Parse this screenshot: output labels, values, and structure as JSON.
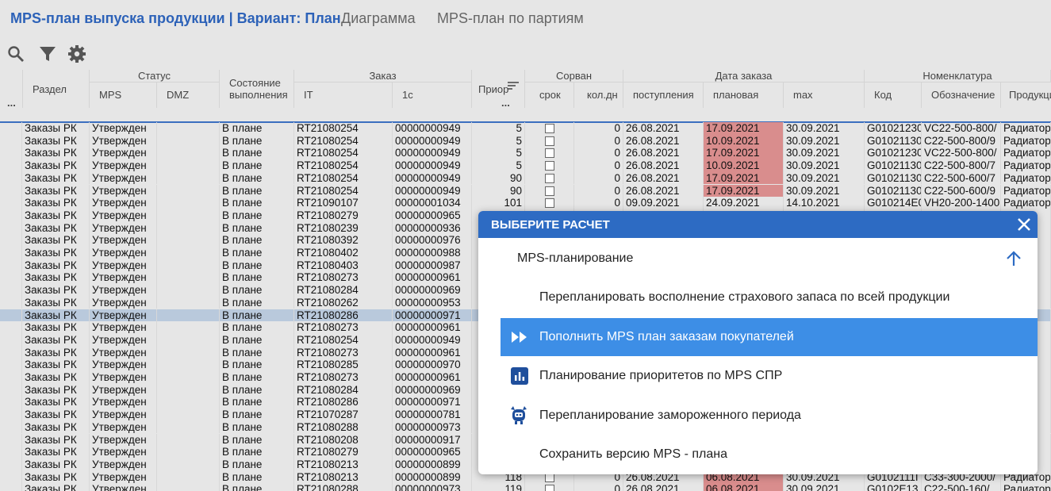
{
  "tabs": [
    {
      "label": "MPS-план выпуска продукции | Вариант: План",
      "active": true
    },
    {
      "label": "Диаграмма",
      "active": false
    },
    {
      "label": "MPS-план по партиям",
      "active": false
    }
  ],
  "toolbar": {
    "icons": [
      "search-icon",
      "filter-icon",
      "gear-icon"
    ]
  },
  "grid": {
    "header_groups": [
      "Статус",
      "Заказ",
      "Сорван",
      "Дата заказа",
      "Номенклатура"
    ],
    "columns": [
      "Раздел",
      "MPS",
      "DMZ",
      "Состояние выполнения",
      "IT",
      "1с",
      "Приор",
      "срок",
      "кол.дн",
      "поступления",
      "плановая",
      "max",
      "Код",
      "Обозначение",
      "Продукция"
    ],
    "more_label": "...",
    "rows": [
      [
        "Заказы РК",
        "Утвержден",
        "",
        "В плане",
        "RT21080254",
        "00000000949",
        "5",
        "",
        "0",
        "26.08.2021",
        "17.09.2021",
        "30.09.2021",
        "G01021230",
        "VC22-500-800/",
        "Радиатор"
      ],
      [
        "Заказы РК",
        "Утвержден",
        "",
        "В плане",
        "RT21080254",
        "00000000949",
        "5",
        "",
        "0",
        "26.08.2021",
        "10.09.2021",
        "30.09.2021",
        "G01021130",
        "C22-500-800/9",
        "Радиатор"
      ],
      [
        "Заказы РК",
        "Утвержден",
        "",
        "В плане",
        "RT21080254",
        "00000000949",
        "5",
        "",
        "0",
        "26.08.2021",
        "17.09.2021",
        "30.09.2021",
        "G01021230",
        "VC22-500-800/",
        "Радиатор"
      ],
      [
        "Заказы РК",
        "Утвержден",
        "",
        "В плане",
        "RT21080254",
        "00000000949",
        "5",
        "",
        "0",
        "26.08.2021",
        "10.09.2021",
        "30.09.2021",
        "G01021130",
        "C22-500-800/7",
        "Радиатор"
      ],
      [
        "Заказы РК",
        "Утвержден",
        "",
        "В плане",
        "RT21080254",
        "00000000949",
        "90",
        "",
        "0",
        "26.08.2021",
        "17.09.2021",
        "30.09.2021",
        "G01021130",
        "C22-500-600/7",
        "Радиатор"
      ],
      [
        "Заказы РК",
        "Утвержден",
        "",
        "В плане",
        "RT21080254",
        "00000000949",
        "90",
        "",
        "0",
        "26.08.2021",
        "17.09.2021",
        "30.09.2021",
        "G01021130",
        "C22-500-600/9",
        "Радиатор"
      ],
      [
        "Заказы РК",
        "Утвержден",
        "",
        "В плане",
        "RT21090107",
        "00000001034",
        "101",
        "",
        "0",
        "09.09.2021",
        "24.09.2021",
        "14.10.2021",
        "G010214E0",
        "VH20-200-1400",
        "Радиатор"
      ],
      [
        "Заказы РК",
        "Утвержден",
        "",
        "В плане",
        "RT21080279",
        "00000000965",
        "",
        "",
        "",
        "",
        "",
        "",
        "",
        "",
        ""
      ],
      [
        "Заказы РК",
        "Утвержден",
        "",
        "В плане",
        "RT21080239",
        "00000000936",
        "",
        "",
        "",
        "",
        "",
        "",
        "",
        "",
        ""
      ],
      [
        "Заказы РК",
        "Утвержден",
        "",
        "В плане",
        "RT21080392",
        "00000000976",
        "",
        "",
        "",
        "",
        "",
        "",
        "",
        "",
        ""
      ],
      [
        "Заказы РК",
        "Утвержден",
        "",
        "В плане",
        "RT21080402",
        "00000000988",
        "",
        "",
        "",
        "",
        "",
        "",
        "",
        "",
        ""
      ],
      [
        "Заказы РК",
        "Утвержден",
        "",
        "В плане",
        "RT21080403",
        "00000000987",
        "",
        "",
        "",
        "",
        "",
        "",
        "",
        "",
        ""
      ],
      [
        "Заказы РК",
        "Утвержден",
        "",
        "В плане",
        "RT21080273",
        "00000000961",
        "",
        "",
        "",
        "",
        "",
        "",
        "",
        "",
        ""
      ],
      [
        "Заказы РК",
        "Утвержден",
        "",
        "В плане",
        "RT21080284",
        "00000000969",
        "",
        "",
        "",
        "",
        "",
        "",
        "",
        "",
        ""
      ],
      [
        "Заказы РК",
        "Утвержден",
        "",
        "В плане",
        "RT21080262",
        "00000000953",
        "",
        "",
        "",
        "",
        "",
        "",
        "",
        "",
        ""
      ],
      [
        "Заказы РК",
        "Утвержден",
        "",
        "В плане",
        "RT21080286",
        "00000000971",
        "",
        "",
        "",
        "",
        "",
        "",
        "",
        "",
        ""
      ],
      [
        "Заказы РК",
        "Утвержден",
        "",
        "В плане",
        "RT21080273",
        "00000000961",
        "",
        "",
        "",
        "",
        "",
        "",
        "",
        "",
        ""
      ],
      [
        "Заказы РК",
        "Утвержден",
        "",
        "В плане",
        "RT21080254",
        "00000000949",
        "",
        "",
        "",
        "",
        "",
        "",
        "",
        "",
        ""
      ],
      [
        "Заказы РК",
        "Утвержден",
        "",
        "В плане",
        "RT21080273",
        "00000000961",
        "",
        "",
        "",
        "",
        "",
        "",
        "",
        "",
        ""
      ],
      [
        "Заказы РК",
        "Утвержден",
        "",
        "В плане",
        "RT21080285",
        "00000000970",
        "",
        "",
        "",
        "",
        "",
        "",
        "",
        "",
        ""
      ],
      [
        "Заказы РК",
        "Утвержден",
        "",
        "В плане",
        "RT21080273",
        "00000000961",
        "",
        "",
        "",
        "",
        "",
        "",
        "",
        "",
        ""
      ],
      [
        "Заказы РК",
        "Утвержден",
        "",
        "В плане",
        "RT21080284",
        "00000000969",
        "",
        "",
        "",
        "",
        "",
        "",
        "",
        "",
        ""
      ],
      [
        "Заказы РК",
        "Утвержден",
        "",
        "В плане",
        "RT21080286",
        "00000000971",
        "",
        "",
        "",
        "",
        "",
        "",
        "",
        "",
        ""
      ],
      [
        "Заказы РК",
        "Утвержден",
        "",
        "В плане",
        "RT21070287",
        "00000000781",
        "",
        "",
        "",
        "",
        "",
        "",
        "",
        "",
        ""
      ],
      [
        "Заказы РК",
        "Утвержден",
        "",
        "В плане",
        "RT21080288",
        "00000000973",
        "",
        "",
        "",
        "",
        "",
        "",
        "",
        "",
        ""
      ],
      [
        "Заказы РК",
        "Утвержден",
        "",
        "В плане",
        "RT21080208",
        "00000000917",
        "",
        "",
        "",
        "",
        "",
        "",
        "",
        "",
        ""
      ],
      [
        "Заказы РК",
        "Утвержден",
        "",
        "В плане",
        "RT21080279",
        "00000000965",
        "",
        "",
        "",
        "",
        "",
        "",
        "",
        "",
        ""
      ],
      [
        "Заказы РК",
        "Утвержден",
        "",
        "В плане",
        "RT21080213",
        "00000000899",
        "",
        "",
        "",
        "",
        "",
        "",
        "",
        "",
        ""
      ],
      [
        "Заказы РК",
        "Утвержден",
        "",
        "В плане",
        "RT21080213",
        "00000000899",
        "118",
        "",
        "0",
        "26.08.2021",
        "06.08.2021",
        "30.09.2021",
        "G0102111П",
        "C33-300-2000/",
        "Радиатор"
      ],
      [
        "Заказы РК",
        "Утвержден",
        "",
        "В плане",
        "RT21080288",
        "00000000973",
        "119",
        "",
        "0",
        "26.08.2021",
        "06.08.2021",
        "30.09.2021",
        "G0102E13",
        "C22-500-160/",
        "Радиатор"
      ]
    ],
    "selected_row": 15,
    "red_planned_rows": [
      0,
      1,
      2,
      3,
      4,
      5,
      28,
      29
    ],
    "colors": {
      "red": "#d98d8d",
      "selected": "#b9c9dc",
      "accent": "#2d62b8"
    }
  },
  "dialog": {
    "title": "ВЫБЕРИТЕ РАСЧЕТ",
    "section": "MPS-планирование",
    "items": [
      {
        "label": "Перепланировать восполнение страхового запаса по всей продукции",
        "icon": "",
        "highlighted": false
      },
      {
        "label": "Пополнить MPS план заказам покупателей",
        "icon": "fast-forward-icon",
        "highlighted": true
      },
      {
        "label": "Планирование приоритетов по MPS СПР",
        "icon": "bar-chart-icon",
        "highlighted": false
      },
      {
        "label": "Перепланирование замороженного периода",
        "icon": "frozen-bot-icon",
        "highlighted": false
      },
      {
        "label": "Сохранить версию MPS - плана",
        "icon": "",
        "highlighted": false
      }
    ],
    "colors": {
      "header": "#2d6bc3",
      "highlight": "#3d8ee6",
      "icon": "#1f4f9c"
    }
  }
}
